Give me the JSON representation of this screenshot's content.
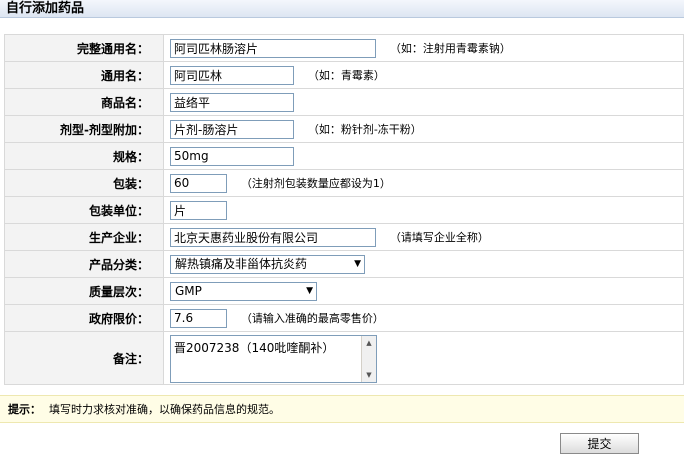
{
  "page": {
    "title": "自行添加药品"
  },
  "form": {
    "full_name": {
      "label": "完整通用名：",
      "value": "阿司匹林肠溶片",
      "hint": "（如：注射用青霉素钠）"
    },
    "generic_name": {
      "label": "通用名：",
      "value": "阿司匹林",
      "hint": "（如：青霉素）"
    },
    "trade_name": {
      "label": "商品名：",
      "value": "益络平"
    },
    "dosage_form": {
      "label": "剂型-剂型附加：",
      "value": "片剂-肠溶片",
      "hint": "（如：粉针剂-冻干粉）"
    },
    "spec": {
      "label": "规格：",
      "value": "50mg"
    },
    "package": {
      "label": "包装：",
      "value": "60",
      "hint": "（注射剂包装数量应都设为1）"
    },
    "package_unit": {
      "label": "包装单位：",
      "value": "片"
    },
    "manufacturer": {
      "label": "生产企业：",
      "value": "北京天惠药业股份有限公司",
      "hint": "（请填写企业全称）"
    },
    "category": {
      "label": "产品分类：",
      "selected": "解热镇痛及非甾体抗炎药"
    },
    "quality": {
      "label": "质量层次：",
      "selected": "GMP"
    },
    "price": {
      "label": "政府限价：",
      "value": "7.6",
      "hint": "（请输入准确的最高零售价）"
    },
    "remark": {
      "label": "备注：",
      "value": "晋2007238（140吡喹酮补）"
    }
  },
  "tip": {
    "label": "提示：",
    "text": "填写时力求核对准确，以确保药品信息的规范。"
  },
  "submit_label": "提交",
  "icons": {
    "select_arrow": "▼",
    "scroll_up": "▲",
    "scroll_down": "▼"
  }
}
